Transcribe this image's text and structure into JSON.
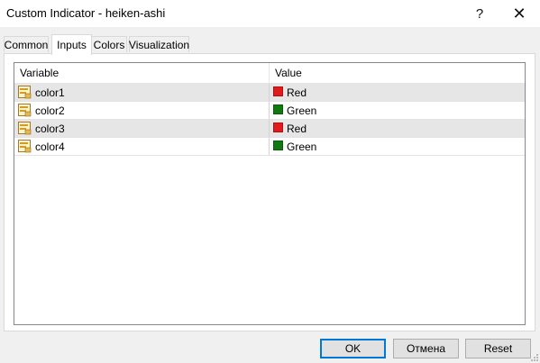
{
  "window": {
    "title": "Custom Indicator - heiken-ashi",
    "help_label": "?",
    "close_label": "✕"
  },
  "tabs": [
    {
      "label": "Common",
      "active": false
    },
    {
      "label": "Inputs",
      "active": true
    },
    {
      "label": "Colors",
      "active": false
    },
    {
      "label": "Visualization",
      "active": false
    }
  ],
  "table": {
    "headers": {
      "variable": "Variable",
      "value": "Value"
    },
    "rows": [
      {
        "variable": "color1",
        "value": "Red",
        "color": "#e31a1c"
      },
      {
        "variable": "color2",
        "value": "Green",
        "color": "#107a10"
      },
      {
        "variable": "color3",
        "value": "Red",
        "color": "#e31a1c"
      },
      {
        "variable": "color4",
        "value": "Green",
        "color": "#107a10"
      }
    ]
  },
  "buttons": {
    "ok": "OK",
    "cancel": "Отмена",
    "reset": "Reset"
  },
  "colors": {
    "accent": "#0078d7",
    "red": "#e31a1c",
    "green": "#107a10"
  }
}
